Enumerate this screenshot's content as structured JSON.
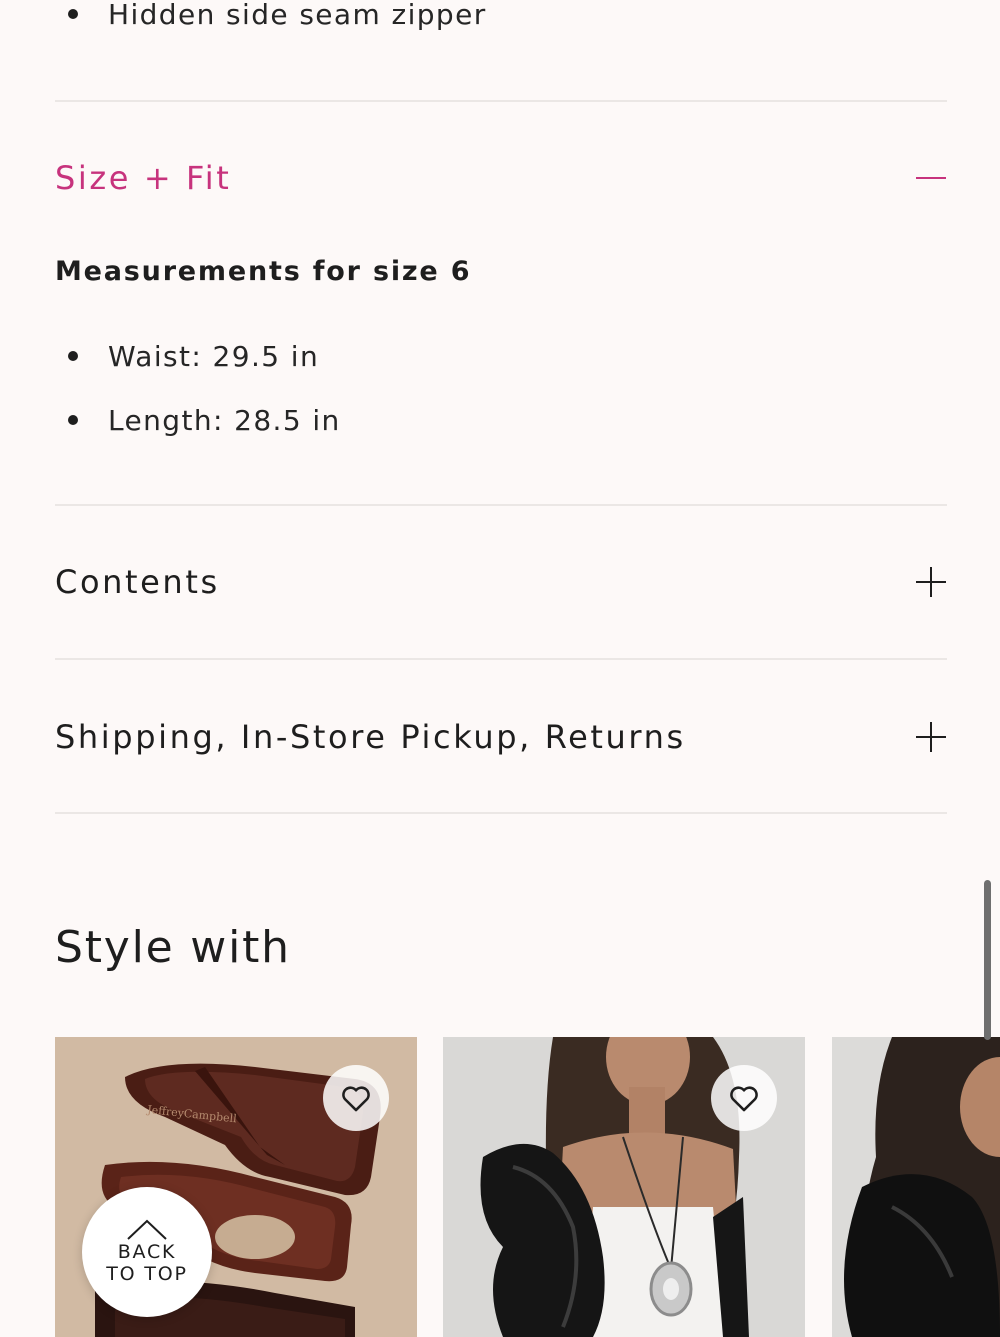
{
  "details": {
    "last_bullet": "Hidden side seam zipper"
  },
  "size_fit": {
    "title": "Size + Fit",
    "expanded": true,
    "measurements_heading": "Measurements for size 6",
    "measurements": [
      {
        "text": "Waist: 29.5 in"
      },
      {
        "text": "Length: 28.5 in"
      }
    ]
  },
  "contents": {
    "title": "Contents",
    "expanded": false
  },
  "shipping": {
    "title": "Shipping, In-Store Pickup, Returns",
    "expanded": false
  },
  "style_with": {
    "heading": "Style with",
    "products": [
      {
        "image": "brown platform thong sandals",
        "favorite_icon": "heart-outline-icon"
      },
      {
        "image": "woman in black ruffle top with silver pendant necklace",
        "favorite_icon": "heart-outline-icon"
      },
      {
        "image": "woman in black bow top",
        "favorite_icon": "heart-outline-icon"
      }
    ]
  },
  "back_to_top": {
    "line1": "BACK",
    "line2": "TO TOP",
    "icon": "chevron-up-icon"
  },
  "colors": {
    "accent": "#c7337d",
    "background": "#fdf9f8",
    "text": "#1e1e1e",
    "divider": "#ebe7e5"
  }
}
